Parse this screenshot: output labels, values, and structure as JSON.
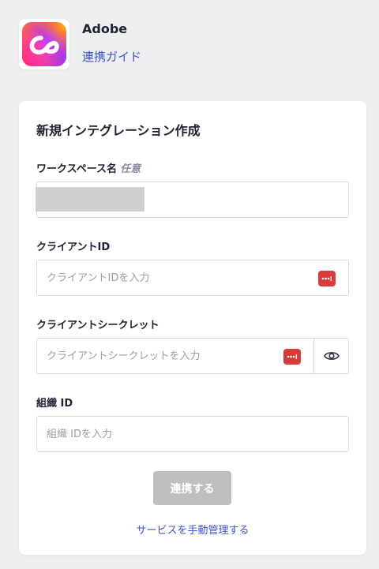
{
  "header": {
    "app_name": "Adobe",
    "guide_link": "連携ガイド",
    "logo_icon": "adobe-creative-cloud-logo"
  },
  "form": {
    "title": "新規インテグレーション作成",
    "workspace": {
      "label": "ワークスペース名",
      "optional_tag": "任意",
      "value": ""
    },
    "client_id": {
      "label": "クライアントID",
      "placeholder": "クライアントIDを入力"
    },
    "client_secret": {
      "label": "クライアントシークレット",
      "placeholder": "クライアントシークレットを入力"
    },
    "org_id": {
      "label": "組織 ID",
      "placeholder": "組織 IDを入力"
    },
    "connect_button": "連携する",
    "manual_link": "サービスを手動管理する"
  },
  "colors": {
    "link": "#3d53c9",
    "password_manager_badge": "#d93a3a",
    "button_disabled": "#bfbfbf"
  }
}
